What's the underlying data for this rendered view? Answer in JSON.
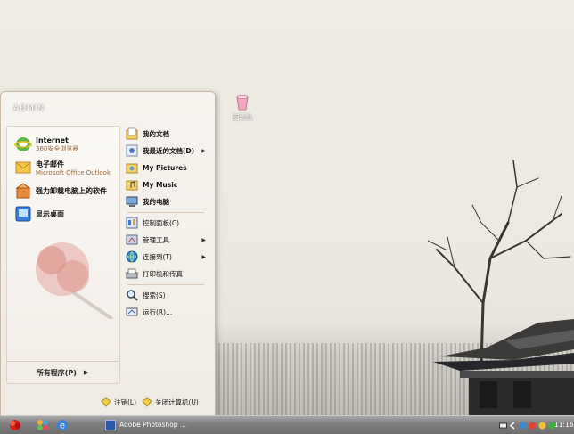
{
  "desktop": {
    "recycle_bin_label": "回收站"
  },
  "start_menu": {
    "user_name": "ADMIN",
    "pinned": [
      {
        "title": "Internet",
        "subtitle": "360安全浏览器",
        "icon": "ie-browser-icon"
      },
      {
        "title": "电子邮件",
        "subtitle": "Microsoft Office Outlook",
        "icon": "outlook-mail-icon"
      },
      {
        "title": "强力卸载电脑上的软件",
        "subtitle": "",
        "icon": "uninstall-box-icon"
      },
      {
        "title": "显示桌面",
        "subtitle": "",
        "icon": "show-desktop-icon"
      }
    ],
    "all_programs": "所有程序(P)",
    "right_items": [
      {
        "label": "我的文档",
        "bold": true,
        "submenu": false,
        "icon": "my-documents-icon"
      },
      {
        "label": "我最近的文档(D)",
        "bold": true,
        "submenu": true,
        "icon": "recent-documents-icon"
      },
      {
        "label": "My Pictures",
        "bold": true,
        "submenu": false,
        "icon": "my-pictures-icon"
      },
      {
        "label": "My Music",
        "bold": true,
        "submenu": false,
        "icon": "my-music-icon"
      },
      {
        "label": "我的电脑",
        "bold": true,
        "submenu": false,
        "icon": "my-computer-icon"
      },
      {
        "label": "控制面板(C)",
        "bold": false,
        "submenu": false,
        "icon": "control-panel-icon"
      },
      {
        "label": "管理工具",
        "bold": false,
        "submenu": true,
        "icon": "admin-tools-icon"
      },
      {
        "label": "连接到(T)",
        "bold": false,
        "submenu": true,
        "icon": "connect-to-icon"
      },
      {
        "label": "打印机和传真",
        "bold": false,
        "submenu": false,
        "icon": "printer-fax-icon"
      },
      {
        "label": "搜索(S)",
        "bold": false,
        "submenu": false,
        "icon": "search-icon"
      },
      {
        "label": "运行(R)...",
        "bold": false,
        "submenu": false,
        "icon": "run-icon"
      }
    ],
    "logoff": "注销(L)",
    "shutdown": "关闭计算机(U)"
  },
  "taskbar": {
    "task_label": "Adobe Photoshop ...",
    "clock": "11:16"
  },
  "colors": {
    "desktop_bg": "#eeebe3",
    "menu_bg": "#f7f4ef",
    "taskbar": "#7f7f7f",
    "subtitle": "#9a6a3a"
  }
}
